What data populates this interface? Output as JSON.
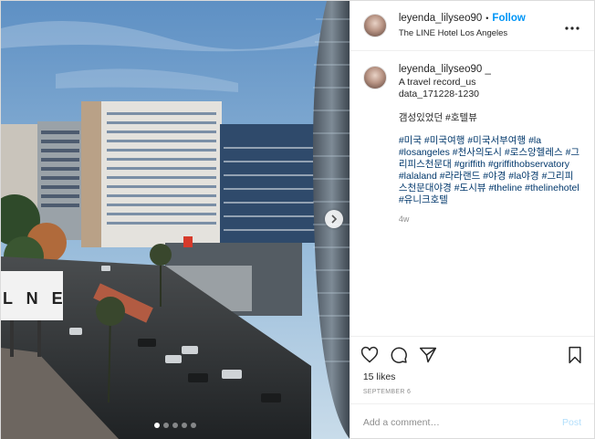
{
  "header": {
    "username": "leyenda_lilyseo90",
    "separator": "•",
    "follow_label": "Follow",
    "location": "The LINE Hotel Los Angeles",
    "more_icon": "more-horizontal-icon"
  },
  "caption": {
    "username": "leyenda_lilyseo90 _",
    "text": "A travel record_us\ndata_171228-1230",
    "title": "갬성있었던 #호텔뷰",
    "hashtags": [
      "#미국",
      "#미국여행",
      "#미국서부여행",
      "#la",
      "#losangeles",
      "#천사의도시",
      "#로스앙헬레스",
      "#그리피스천문대",
      "#griffith",
      "#griffithobservatory",
      "#lalaland",
      "#라라랜드",
      "#야경",
      "#la야경",
      "#그리피스천문대야경",
      "#도시뷰",
      "#theline",
      "#thelinehotel",
      "#유니크호텔"
    ],
    "time": "4w"
  },
  "photo": {
    "sign_text": "L N E",
    "carousel_dots": 5,
    "active_dot": 0
  },
  "actions": {
    "like_icon": "heart-icon",
    "comment_icon": "comment-icon",
    "share_icon": "share-icon",
    "save_icon": "bookmark-icon",
    "likes": "15 likes",
    "date": "SEPTEMBER 6"
  },
  "comment_box": {
    "placeholder": "Add a comment…",
    "post_label": "Post"
  },
  "colors": {
    "follow": "#0095f6",
    "hashtag": "#00376b",
    "post_disabled": "#b2dffc",
    "muted": "#8e8e8e"
  }
}
